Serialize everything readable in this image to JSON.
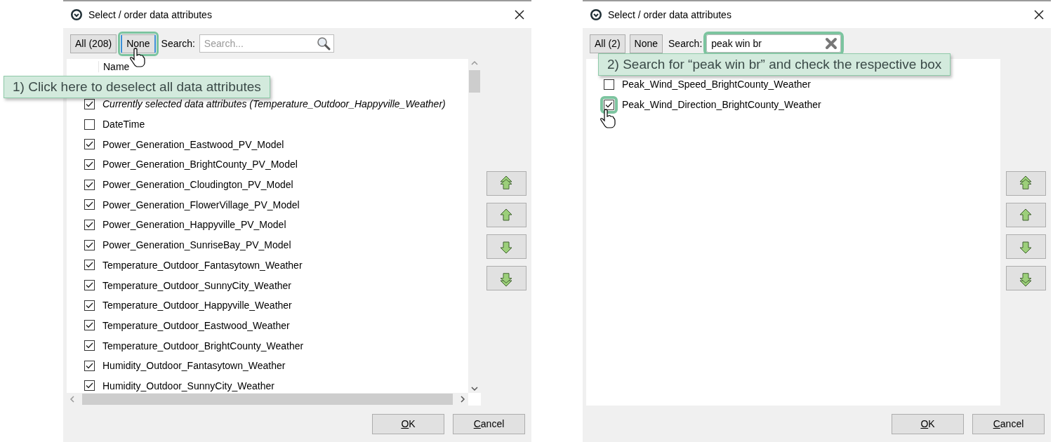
{
  "dialogs": [
    {
      "title": "Select / order data attributes",
      "all_button": "All (208)",
      "none_button": {
        "label": "None",
        "highlighted": true
      },
      "search_label": "Search:",
      "search": {
        "placeholder": "Search...",
        "highlighted": false
      },
      "column_header": "Name",
      "scrollbars": true,
      "callout": "1) Click here to deselect all data attributes",
      "rows": [
        {
          "label": "Currently selected data attributes (Temperature_Outdoor_Happyville_Weather)",
          "checked": true,
          "italic": true,
          "highlighted": false
        },
        {
          "label": "DateTime",
          "checked": false,
          "italic": false,
          "highlighted": false
        },
        {
          "label": "Power_Generation_Eastwood_PV_Model",
          "checked": true,
          "italic": false,
          "highlighted": false
        },
        {
          "label": "Power_Generation_BrightCounty_PV_Model",
          "checked": true,
          "italic": false,
          "highlighted": false
        },
        {
          "label": "Power_Generation_Cloudington_PV_Model",
          "checked": true,
          "italic": false,
          "highlighted": false
        },
        {
          "label": "Power_Generation_FlowerVillage_PV_Model",
          "checked": true,
          "italic": false,
          "highlighted": false
        },
        {
          "label": "Power_Generation_Happyville_PV_Model",
          "checked": true,
          "italic": false,
          "highlighted": false
        },
        {
          "label": "Power_Generation_SunriseBay_PV_Model",
          "checked": true,
          "italic": false,
          "highlighted": false
        },
        {
          "label": "Temperature_Outdoor_Fantasytown_Weather",
          "checked": true,
          "italic": false,
          "highlighted": false
        },
        {
          "label": "Temperature_Outdoor_SunnyCity_Weather",
          "checked": true,
          "italic": false,
          "highlighted": false
        },
        {
          "label": "Temperature_Outdoor_Happyville_Weather",
          "checked": true,
          "italic": false,
          "highlighted": false
        },
        {
          "label": "Temperature_Outdoor_Eastwood_Weather",
          "checked": true,
          "italic": false,
          "highlighted": false
        },
        {
          "label": "Temperature_Outdoor_BrightCounty_Weather",
          "checked": true,
          "italic": false,
          "highlighted": false
        },
        {
          "label": "Humidity_Outdoor_Fantasytown_Weather",
          "checked": true,
          "italic": false,
          "highlighted": false
        },
        {
          "label": "Humidity_Outdoor_SunnyCity_Weather",
          "checked": true,
          "italic": false,
          "highlighted": false
        }
      ],
      "buttons": [
        {
          "label": "OK"
        },
        {
          "label": "Cancel"
        }
      ]
    },
    {
      "title": "Select / order data attributes",
      "all_button": "All (2)",
      "none_button": {
        "label": "None",
        "highlighted": false
      },
      "search_label": "Search:",
      "search": {
        "value": "peak win br",
        "highlighted": true
      },
      "scrollbars": false,
      "callout": "2) Search for “peak win br” and check the respective box",
      "rows": [
        {
          "label": "Peak_Wind_Speed_BrightCounty_Weather",
          "checked": false,
          "italic": false,
          "highlighted": false
        },
        {
          "label": "Peak_Wind_Direction_BrightCounty_Weather",
          "checked": true,
          "italic": false,
          "highlighted": true
        }
      ],
      "buttons": [
        {
          "label": "OK"
        },
        {
          "label": "Cancel"
        }
      ]
    }
  ]
}
